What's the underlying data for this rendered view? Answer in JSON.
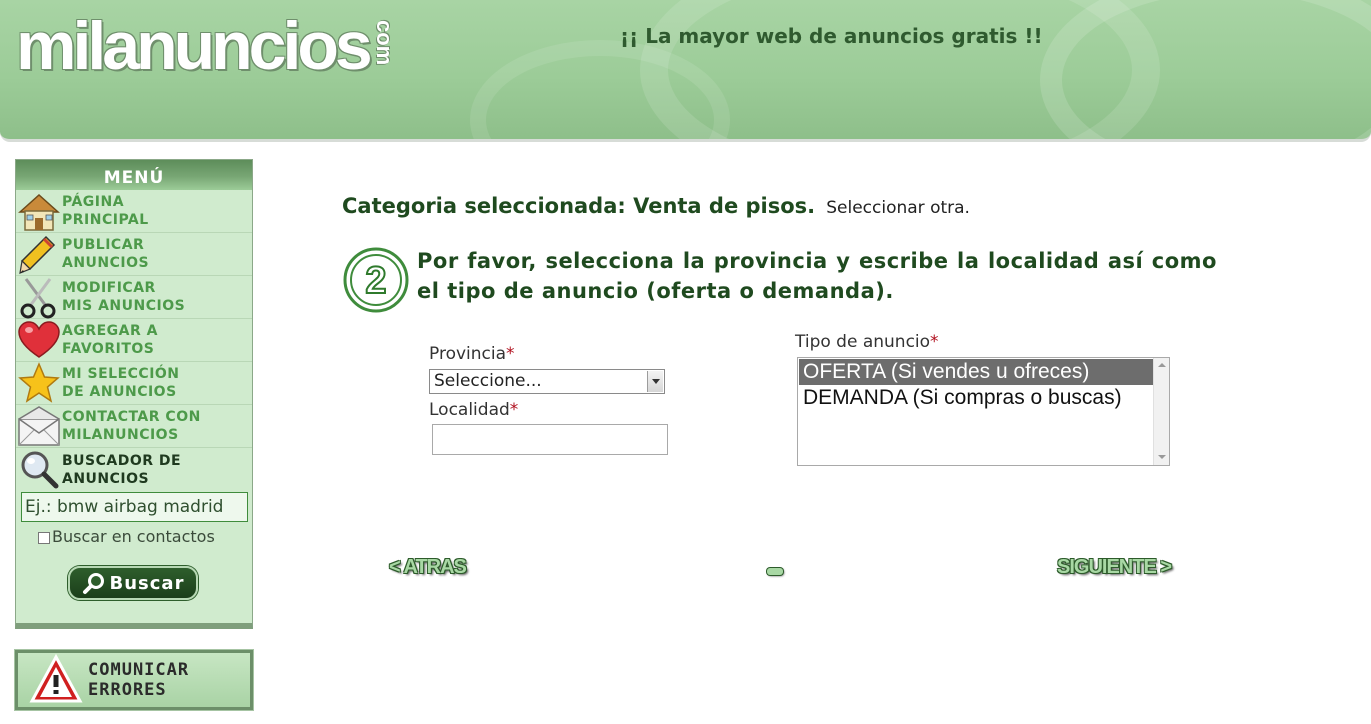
{
  "header": {
    "logo_main": "milanuncios",
    "logo_com": "com",
    "tagline": "¡¡ La mayor web de anuncios gratis !!"
  },
  "menu": {
    "title": "MENÚ",
    "items": [
      {
        "line1": "PÁGINA",
        "line2": "PRINCIPAL",
        "icon": "home-icon"
      },
      {
        "line1": "PUBLICAR",
        "line2": "ANUNCIOS",
        "icon": "pencil-icon"
      },
      {
        "line1": "MODIFICAR",
        "line2": "MIS ANUNCIOS",
        "icon": "scissors-icon"
      },
      {
        "line1": "AGREGAR A",
        "line2": "FAVORITOS",
        "icon": "heart-icon"
      },
      {
        "line1": "MI SELECCIÓN",
        "line2": "DE ANUNCIOS",
        "icon": "star-icon"
      },
      {
        "line1": "CONTACTAR CON",
        "line2": "MILANUNCIOS",
        "icon": "envelope-icon"
      },
      {
        "line1": "BUSCADOR DE",
        "line2": "ANUNCIOS",
        "icon": "magnifier-icon"
      }
    ],
    "search_placeholder": "Ej.: bmw airbag madrid",
    "checkbox_label": "Buscar en contactos",
    "search_button": "Buscar"
  },
  "report": {
    "line1": "COMUNICAR",
    "line2": "ERRORES"
  },
  "main": {
    "category_label": "Categoria seleccionada: Venta de pisos.",
    "category_change": "Seleccionar otra.",
    "step_number": "2",
    "step_text": "Por favor, selecciona la provincia y escribe la localidad así como el tipo de anuncio (oferta o demanda).",
    "provincia_label": "Provincia",
    "provincia_value": "Seleccione...",
    "localidad_label": "Localidad",
    "tipo_label": "Tipo de anuncio",
    "required_mark": "*",
    "tipo_options": [
      "OFERTA (Si vendes u ofreces)",
      "DEMANDA (Si compras o buscas)"
    ],
    "back_button": "< ATRAS",
    "next_button": "SIGUIENTE >"
  },
  "colors": {
    "accent": "#1f4a1f",
    "menu_bg": "#d0ebce",
    "header_bg": "#9ccc98",
    "required": "#b0101e"
  }
}
